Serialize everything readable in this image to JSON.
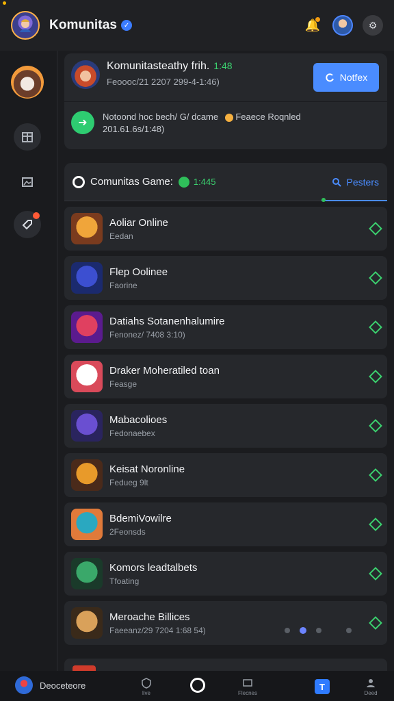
{
  "app": {
    "title": "Komunitas",
    "verified_icon": "check-badge-icon"
  },
  "topbar": {
    "icons": [
      "bell-icon",
      "user-avatar",
      "settings-avatar"
    ]
  },
  "sidebar": {
    "items": [
      "profile-avatar",
      "shop-icon",
      "image-icon",
      "tag-icon"
    ]
  },
  "header_card": {
    "title": "Komunitasteathy frih.",
    "count": "1:48",
    "subtitle": "Feoooc/21 2207 299-4-1:46)",
    "button_label": "Notfex",
    "message": "Notoond hoc bech/ G/ dcame",
    "message_tail": "Feaece Roqnled",
    "message_sub": "201.61.6s/1:48)"
  },
  "list": {
    "title": "Comunitas Game:",
    "count": "1:445",
    "search_label": "Pesters",
    "games": [
      {
        "name": "Aoliar Online",
        "sub": "Eedan",
        "thumb": [
          "#f0a53a",
          "#7a3b1e"
        ]
      },
      {
        "name": "Flep Oolinee",
        "sub": "Faorine",
        "thumb": [
          "#3c4fd1",
          "#1b2a6e"
        ]
      },
      {
        "name": "Datiahs Sotanenhalumire",
        "sub": "Fenonez/ 7408 3:10)",
        "thumb": [
          "#e04060",
          "#5b1b8e"
        ]
      },
      {
        "name": "Draker Moheratiled toan",
        "sub": "Feasge",
        "thumb": [
          "#ffffff",
          "#d94a5a"
        ]
      },
      {
        "name": "Mabacolioes",
        "sub": "Fedonaebex",
        "thumb": [
          "#6a4fd1",
          "#2a245e"
        ]
      },
      {
        "name": "Keisat Noronline",
        "sub": "Fedueg 9lt",
        "thumb": [
          "#e89a2a",
          "#4a2a1a"
        ]
      },
      {
        "name": "BdemiVowilre",
        "sub": "2Feonsds",
        "thumb": [
          "#2aa8c0",
          "#e07a3a"
        ]
      },
      {
        "name": "Komors leadtalbets",
        "sub": "Tfoating",
        "thumb": [
          "#3aa86a",
          "#1a3a2a"
        ]
      },
      {
        "name": "Meroache Billices",
        "sub": "Faeeanz/29 7204 1:68 54)",
        "thumb": [
          "#d9a15a",
          "#3a2a1a"
        ]
      }
    ]
  },
  "bottom_nav": {
    "user_label": "Deoceteore",
    "items": [
      "live",
      "home",
      "Flecnes",
      "tab-t",
      "Deed"
    ],
    "live_label": "live",
    "flecnes_label": "Flecnes",
    "deed_label": "Deed",
    "t_label": "T"
  }
}
